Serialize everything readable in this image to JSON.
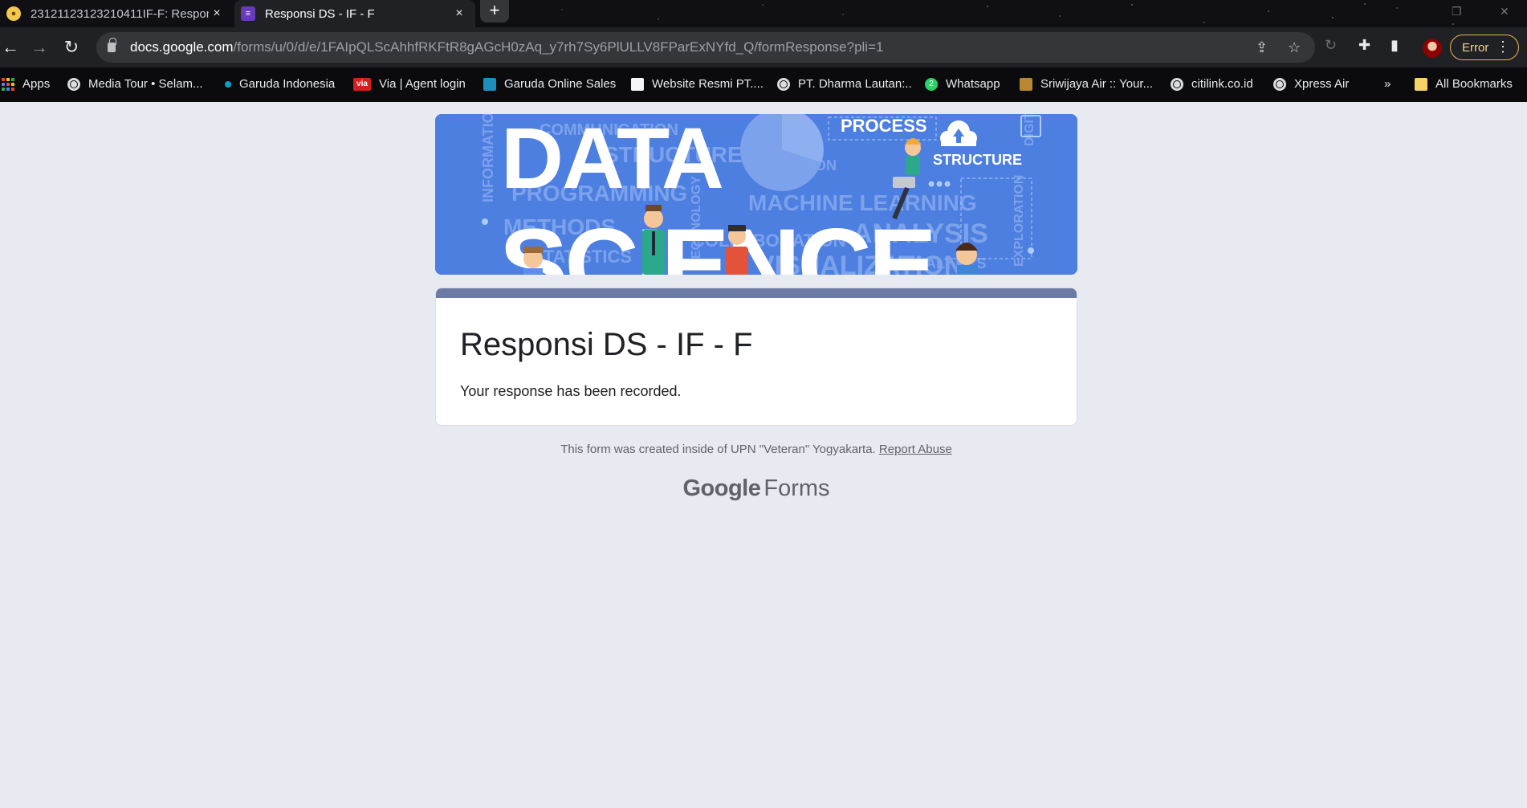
{
  "browser": {
    "tabs": [
      {
        "title": "23121123123210411IF-F: Respon",
        "active": false
      },
      {
        "title": "Responsi DS - IF - F",
        "active": true
      }
    ],
    "new_tab_symbol": "+",
    "close_symbol": "×",
    "url_host": "docs.google.com",
    "url_path": "/forms/u/0/d/e/1FAIpQLScAhhfRKFtR8gAGcH0zAq_y7rh7Sy6PlULLV8FParExNYfd_Q/formResponse?pli=1",
    "profile_status": "Error",
    "icons": [
      "back-icon",
      "forward-icon",
      "reload-icon",
      "share-icon",
      "star-icon",
      "extensions-icon",
      "sidebar-icon",
      "menu-icon"
    ]
  },
  "bookmarks": {
    "items": [
      "Apps",
      "Media Tour • Selam...",
      "Garuda Indonesia",
      "Via | Agent login",
      "Garuda Online Sales",
      "Website Resmi PT....",
      "PT. Dharma Lautan:..",
      "Whatsapp",
      "Sriwijaya Air :: Your...",
      "citilink.co.id",
      "Xpress Air"
    ],
    "overflow": "»",
    "all_bookmarks": "All Bookmarks",
    "via_badge": "via",
    "wa_badge": "2"
  },
  "banner": {
    "word1": "DATA",
    "word2": "SCIENCE",
    "terms": [
      "PROCESS",
      "STRUCTURE",
      "INTUITION",
      "PROGRAMMING",
      "METHODS",
      "STATISTICS",
      "ANALYSIS",
      "INFORMATION",
      "COMMUNICATION",
      "MACHINE LEARNING",
      "TECHNOLOGY",
      "COLLABORATION",
      "DIGITAL",
      "EXPLORATION",
      "VISUALIZATION",
      "ANALYTICS"
    ],
    "colors": {
      "background": "#4d7fe0",
      "text": "#ffffff",
      "faint": "#7da2ec"
    }
  },
  "form": {
    "title": "Responsi DS - IF - F",
    "message": "Your response has been recorded.",
    "accent_color": "#6b7ba5"
  },
  "footer": {
    "note": "This form was created inside of UPN \"Veteran\" Yogyakarta.",
    "report_link": "Report Abuse",
    "brand_google": "Google",
    "brand_forms": "Forms"
  }
}
